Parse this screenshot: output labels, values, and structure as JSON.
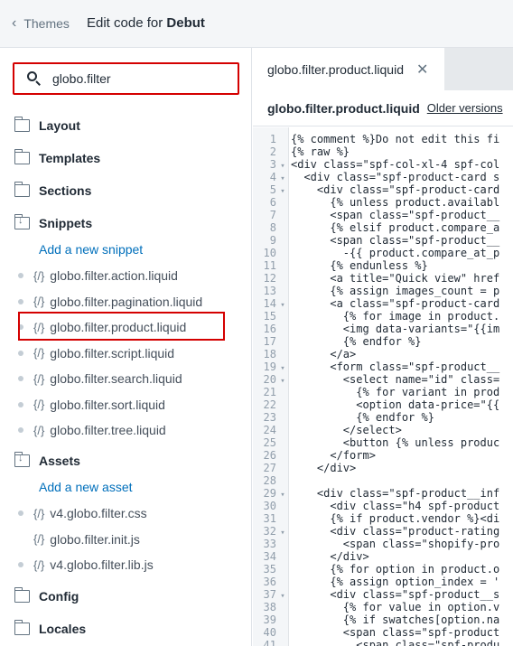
{
  "header": {
    "back_label": "Themes",
    "title_prefix": "Edit code for",
    "theme_name": "Debut"
  },
  "sidebar": {
    "search_value": "globo.filter",
    "folders": {
      "layout": "Layout",
      "templates": "Templates",
      "sections": "Sections",
      "snippets": "Snippets",
      "assets": "Assets",
      "config": "Config",
      "locales": "Locales"
    },
    "add_snippet": "Add a new snippet",
    "add_asset": "Add a new asset",
    "code_glyph": "{/}",
    "snippets": [
      "globo.filter.action.liquid",
      "globo.filter.pagination.liquid",
      "globo.filter.product.liquid",
      "globo.filter.script.liquid",
      "globo.filter.search.liquid",
      "globo.filter.sort.liquid",
      "globo.filter.tree.liquid"
    ],
    "assets": [
      "v4.globo.filter.css",
      "globo.filter.init.js",
      "v4.globo.filter.lib.js"
    ]
  },
  "editor": {
    "tab_label": "globo.filter.product.liquid",
    "file_name": "globo.filter.product.liquid",
    "older_versions": "Older versions",
    "lines": [
      "{% comment %}Do not edit this fi",
      "{% raw %}",
      "<div class=\"spf-col-xl-4 spf-col",
      "  <div class=\"spf-product-card s",
      "    <div class=\"spf-product-card",
      "      {% unless product.availabl",
      "      <span class=\"spf-product__",
      "      {% elsif product.compare_a",
      "      <span class=\"spf-product__",
      "        -{{ product.compare_at_p",
      "      {% endunless %}",
      "      <a title=\"Quick view\" href",
      "      {% assign images_count = p",
      "      <a class=\"spf-product-card",
      "        {% for image in product.",
      "        <img data-variants=\"{{im",
      "        {% endfor %}",
      "      </a>",
      "      <form class=\"spf-product__",
      "        <select name=\"id\" class=",
      "          {% for variant in prod",
      "          <option data-price=\"{{",
      "          {% endfor %}",
      "        </select>",
      "        <button {% unless produc",
      "      </form>",
      "    </div>",
      "",
      "    <div class=\"spf-product__inf",
      "      <div class=\"h4 spf-product",
      "      {% if product.vendor %}<di",
      "      <div class=\"product-rating",
      "        <span class=\"shopify-pro",
      "      </div>",
      "      {% for option in product.o",
      "      {% assign option_index = '",
      "      <div class=\"spf-product__s",
      "        {% for value in option.v",
      "        {% if swatches[option.na",
      "        <span class=\"spf-product",
      "          <span class=\"spf-produ"
    ],
    "fold_markers": [
      3,
      4,
      5,
      14,
      19,
      20,
      29,
      32,
      37
    ]
  }
}
